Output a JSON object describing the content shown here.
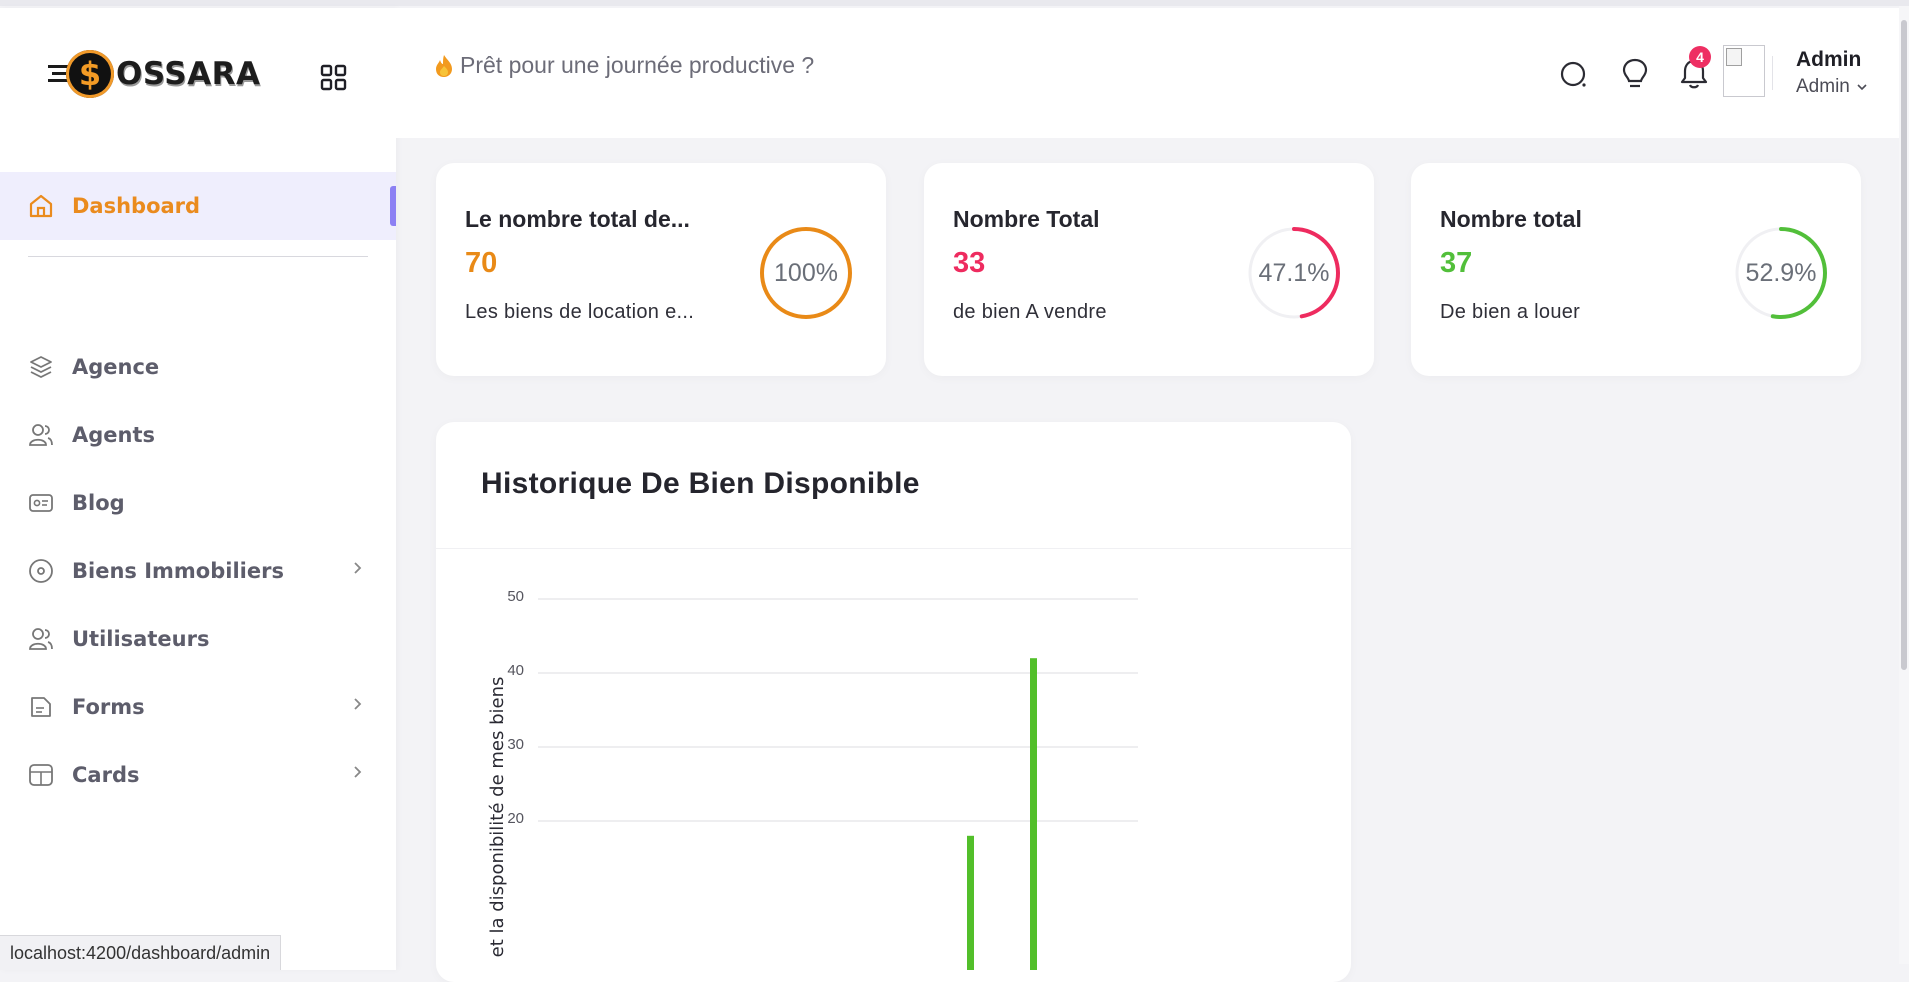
{
  "brand": {
    "name": "OSSARA",
    "coin_symbol": "$"
  },
  "sidebar": {
    "items": [
      {
        "label": "Dashboard",
        "icon": "home-icon",
        "active": true,
        "has_submenu": false
      },
      {
        "label": "Agence",
        "icon": "layers-icon",
        "active": false,
        "has_submenu": false
      },
      {
        "label": "Agents",
        "icon": "users-icon",
        "active": false,
        "has_submenu": false
      },
      {
        "label": "Blog",
        "icon": "id-card-icon",
        "active": false,
        "has_submenu": false
      },
      {
        "label": "Biens Immobiliers",
        "icon": "disc-icon",
        "active": false,
        "has_submenu": true
      },
      {
        "label": "Utilisateurs",
        "icon": "users-icon",
        "active": false,
        "has_submenu": false
      },
      {
        "label": "Forms",
        "icon": "file-icon",
        "active": false,
        "has_submenu": true
      },
      {
        "label": "Cards",
        "icon": "layout-icon",
        "active": false,
        "has_submenu": true
      }
    ]
  },
  "header": {
    "greeting": "Prêt pour une journée productive ?",
    "notifications_count": "4",
    "user_name": "Admin",
    "user_role": "Admin"
  },
  "stats": [
    {
      "title": "Le nombre total de...",
      "value": "70",
      "description": "Les biens de location e...",
      "percent_label": "100%",
      "percent": 100,
      "color": "#e98a17"
    },
    {
      "title": "Nombre Total",
      "value": "33",
      "description": "de bien A vendre",
      "percent_label": "47.1%",
      "percent": 47.1,
      "color": "#ee2b5f"
    },
    {
      "title": "Nombre total",
      "value": "37",
      "description": "De bien a louer",
      "percent_label": "52.9%",
      "percent": 52.9,
      "color": "#52bf3a"
    }
  ],
  "chart_data": {
    "type": "bar",
    "title": "Historique De Bien Disponible",
    "ylabel": "et la disponibilité de mes biens",
    "yticks": [
      20,
      30,
      40,
      50
    ],
    "ylim": [
      13,
      50
    ],
    "grid": true,
    "bar_color": "#52bf2a",
    "values": [
      18,
      42
    ]
  },
  "status_bar": {
    "url": "localhost:4200/dashboard/admin"
  }
}
